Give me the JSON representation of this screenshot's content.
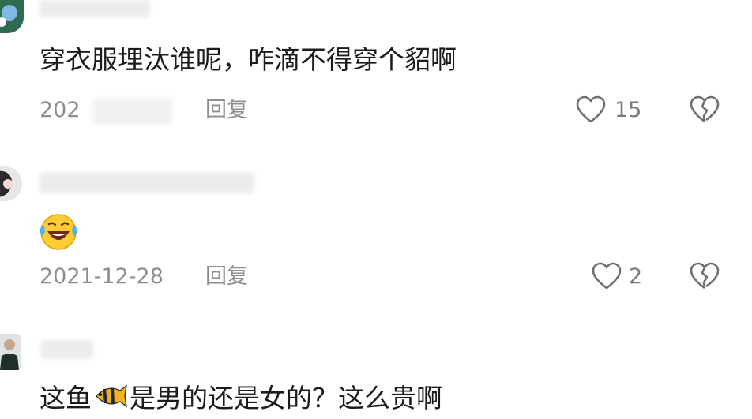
{
  "comments": [
    {
      "text": "穿衣服埋汰谁呢，咋滴不得穿个貂啊",
      "date": "202",
      "reply_label": "回复",
      "likes": "15"
    },
    {
      "text": "",
      "date": "2021-12-28",
      "reply_label": "回复",
      "likes": "2",
      "emoji": "laughing-with-tears"
    },
    {
      "text_before": "这鱼",
      "text_after": "是男的还是女的？这么贵啊",
      "emoji": "tropical-fish"
    }
  ],
  "colors": {
    "meta": "#8e8e8e",
    "text": "#1c1c1c",
    "icon": "#6f6f6f"
  }
}
